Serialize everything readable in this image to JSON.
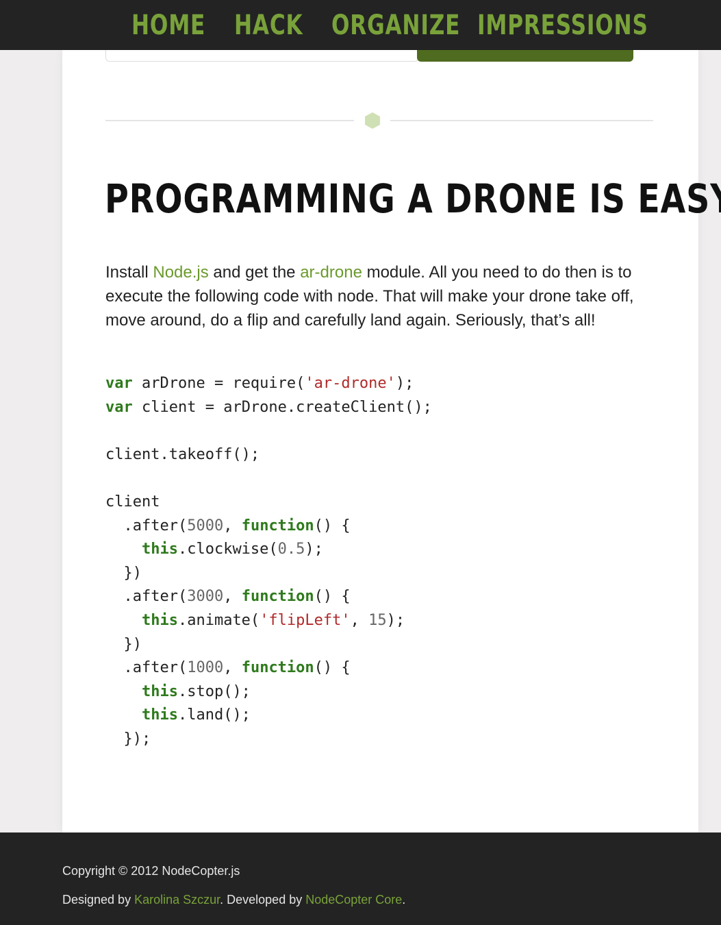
{
  "nav": {
    "items": [
      {
        "label": "HOME"
      },
      {
        "label": "HACK"
      },
      {
        "label": "ORGANIZE"
      },
      {
        "label": "IMPRESSIONS"
      }
    ]
  },
  "main": {
    "title": "PROGRAMMING A DRONE IS EASY!",
    "intro": {
      "part1": "Install ",
      "link1": "Node.js",
      "part2": " and get the ",
      "link2": "ar-drone",
      "part3": " module. All you need to do then is to execute the following code with node. That will make your drone take off, move around, do a flip and carefully land again. Seriously, that’s all!"
    }
  },
  "code": {
    "kw_var": "var",
    "kw_function": "function",
    "kw_this": "this",
    "line1_a": " arDrone = require(",
    "line1_str": "'ar-drone'",
    "line1_b": ");",
    "line2_a": " client = arDrone.createClient();",
    "line3": "client.takeoff();",
    "line4": "client",
    "after_prefix": "  .after(",
    "after_suffix": ", ",
    "after_tail": "() {",
    "indent": "    ",
    "n5000": "5000",
    "n3000": "3000",
    "n1000": "1000",
    "clockwise_a": ".clockwise(",
    "clockwise_num": "0.5",
    "clockwise_b": ");",
    "close": "  })",
    "animate_a": ".animate(",
    "animate_str": "'flipLeft'",
    "animate_b": ", ",
    "animate_num": "15",
    "animate_c": ");",
    "stop": ".stop();",
    "land": ".land();",
    "close_final": "  });"
  },
  "footer": {
    "copyright": "Copyright © 2012 NodeCopter.js",
    "designed_prefix": "Designed by ",
    "designer": "Karolina Szczur",
    "developed_prefix": ". Developed by ",
    "developer": "NodeCopter Core",
    "end": "."
  },
  "colors": {
    "accent": "#79a23a",
    "header_bg": "#232323",
    "keyword": "#2e7a1c",
    "string": "#b02a2a"
  }
}
